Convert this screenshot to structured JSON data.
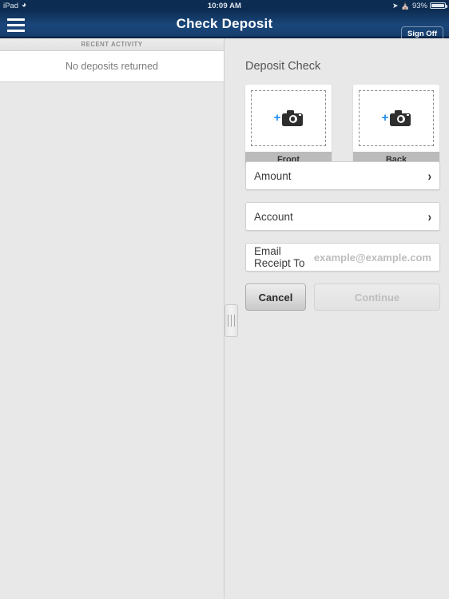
{
  "status_bar": {
    "carrier": "iPad",
    "wifi_icon": "wifi-icon",
    "time": "10:09 AM",
    "location_icon": "location-arrow-icon",
    "headphones_icon": "headphones-icon",
    "battery_percent": "93%",
    "battery_icon": "battery-icon"
  },
  "navbar": {
    "menu_icon": "hamburger-menu-icon",
    "title": "Check Deposit",
    "sign_off_label": "Sign Off",
    "background_color": "#19467a"
  },
  "left_pane": {
    "section_header": "RECENT ACTIVITY",
    "empty_message": "No deposits returned"
  },
  "divider": {
    "handle_icon": "drag-handle-icon"
  },
  "right_pane": {
    "title": "Deposit Check",
    "capture": [
      {
        "label": "Front",
        "icon": "camera-add-icon",
        "plus": "+"
      },
      {
        "label": "Back",
        "icon": "camera-add-icon",
        "plus": "+"
      }
    ],
    "fields": [
      {
        "label": "Amount",
        "value": "",
        "chevron": "›"
      },
      {
        "label": "Account",
        "value": "",
        "chevron": "›"
      }
    ],
    "email": {
      "label": "Email Receipt To",
      "value": "",
      "placeholder": "example@example.com"
    },
    "buttons": {
      "cancel_label": "Cancel",
      "continue_label": "Continue"
    },
    "accent_color": "#1f8bf0"
  }
}
